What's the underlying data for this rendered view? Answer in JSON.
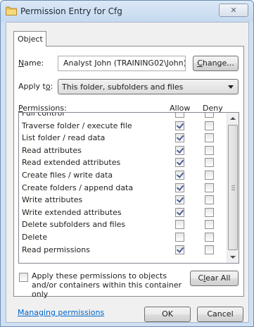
{
  "window": {
    "title": "Permission Entry for Cfg",
    "close_symbol": "✕"
  },
  "tabs": [
    {
      "label": "Object"
    }
  ],
  "name_field": {
    "label": "Name:",
    "value": "Analyst John (TRAINING02\\John)",
    "change_button": "Change..."
  },
  "apply_to": {
    "label": "Apply to:",
    "selected": "This folder, subfolders and files"
  },
  "permissions": {
    "header": "Permissions:",
    "allow_header": "Allow",
    "deny_header": "Deny",
    "rows": [
      {
        "label": "Full control",
        "allow": false,
        "deny": false
      },
      {
        "label": "Traverse folder / execute file",
        "allow": true,
        "deny": false
      },
      {
        "label": "List folder / read data",
        "allow": true,
        "deny": false
      },
      {
        "label": "Read attributes",
        "allow": true,
        "deny": false
      },
      {
        "label": "Read extended attributes",
        "allow": true,
        "deny": false
      },
      {
        "label": "Create files / write data",
        "allow": true,
        "deny": false
      },
      {
        "label": "Create folders / append data",
        "allow": true,
        "deny": false
      },
      {
        "label": "Write attributes",
        "allow": true,
        "deny": false
      },
      {
        "label": "Write extended attributes",
        "allow": true,
        "deny": false
      },
      {
        "label": "Delete subfolders and files",
        "allow": false,
        "deny": false
      },
      {
        "label": "Delete",
        "allow": false,
        "deny": false
      },
      {
        "label": "Read permissions",
        "allow": true,
        "deny": false
      }
    ]
  },
  "apply_option": {
    "label": "Apply these permissions to objects and/or containers within this container only",
    "checked": false
  },
  "clear_all_button": "Clear All",
  "managing_link": "Managing permissions",
  "ok_button": "OK",
  "cancel_button": "Cancel",
  "icons": {
    "title_icon": "folder-icon",
    "close_icon": "close-icon",
    "dropdown_icon": "chevron-down-icon",
    "scroll_up_icon": "scroll-up-arrow-icon",
    "scroll_down_icon": "scroll-down-arrow-icon"
  },
  "colors": {
    "title_bar": "#cfe0f3",
    "link": "#0066cc",
    "checkmark": "#4a5f97"
  }
}
